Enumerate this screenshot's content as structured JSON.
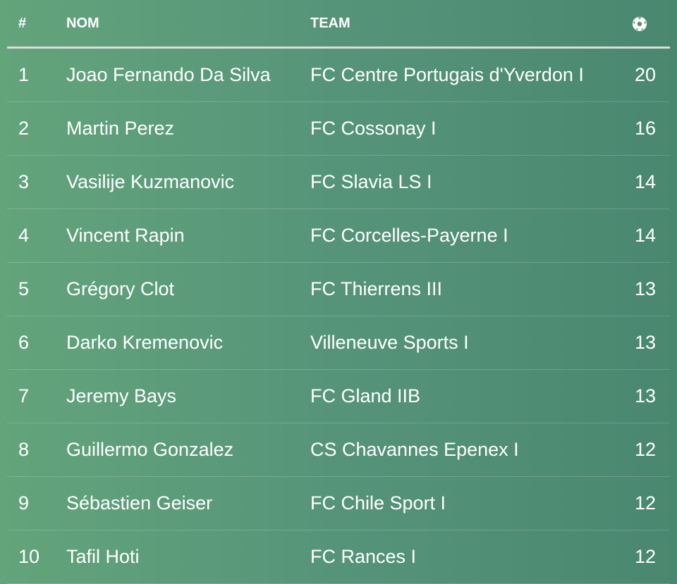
{
  "header": {
    "rank": "#",
    "name": "NOM",
    "team": "TEAM",
    "goals_icon": "soccer-ball-icon"
  },
  "rows": [
    {
      "rank": "1",
      "name": "Joao Fernando Da Silva",
      "team": "FC Centre Portugais d'Yverdon I",
      "goals": "20"
    },
    {
      "rank": "2",
      "name": "Martin Perez",
      "team": "FC Cossonay I",
      "goals": "16"
    },
    {
      "rank": "3",
      "name": "Vasilije Kuzmanovic",
      "team": "FC Slavia LS I",
      "goals": "14"
    },
    {
      "rank": "4",
      "name": "Vincent Rapin",
      "team": "FC Corcelles-Payerne I",
      "goals": "14"
    },
    {
      "rank": "5",
      "name": "Grégory Clot",
      "team": "FC Thierrens III",
      "goals": "13"
    },
    {
      "rank": "6",
      "name": "Darko Kremenovic",
      "team": "Villeneuve Sports I",
      "goals": "13"
    },
    {
      "rank": "7",
      "name": "Jeremy Bays",
      "team": "FC Gland IIB",
      "goals": "13"
    },
    {
      "rank": "8",
      "name": "Guillermo Gonzalez",
      "team": "CS Chavannes Epenex I",
      "goals": "12"
    },
    {
      "rank": "9",
      "name": "Sébastien Geiser",
      "team": "FC Chile Sport I",
      "goals": "12"
    },
    {
      "rank": "10",
      "name": "Tafil Hoti",
      "team": "FC Rances I",
      "goals": "12"
    }
  ]
}
